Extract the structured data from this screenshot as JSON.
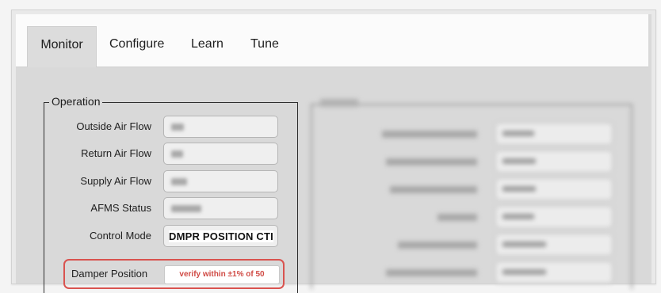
{
  "tabs": [
    {
      "label": "Monitor",
      "active": true
    },
    {
      "label": "Configure",
      "active": false
    },
    {
      "label": "Learn",
      "active": false
    },
    {
      "label": "Tune",
      "active": false
    }
  ],
  "operation": {
    "legend": "Operation",
    "rows": [
      {
        "label": "Outside Air Flow",
        "value": null
      },
      {
        "label": "Return Air Flow",
        "value": null
      },
      {
        "label": "Supply Air Flow",
        "value": null
      },
      {
        "label": "AFMS Status",
        "value": null
      },
      {
        "label": "Control Mode",
        "value": "DMPR POSITION CTI"
      },
      {
        "label": "Damper Position",
        "value": "verify within ±1% of 50"
      }
    ]
  },
  "colors": {
    "highlight": "#d9534f",
    "highlight_text": "#d04a44"
  }
}
